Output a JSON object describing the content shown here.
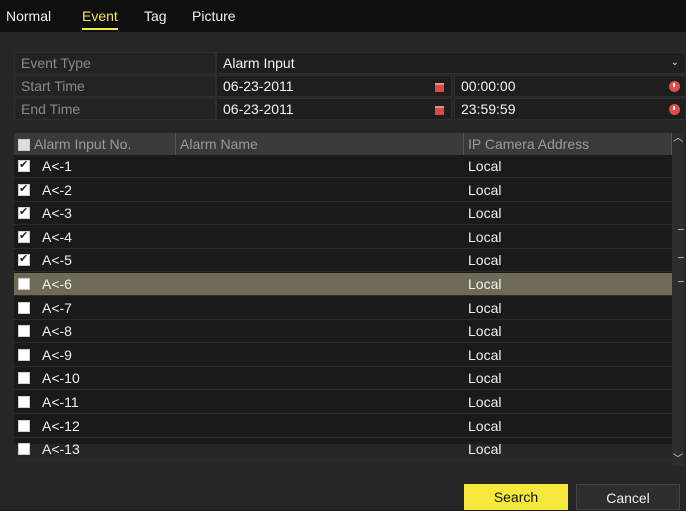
{
  "tabs": [
    {
      "label": "Normal"
    },
    {
      "label": "Event"
    },
    {
      "label": "Tag"
    },
    {
      "label": "Picture"
    }
  ],
  "active_tab": "Event",
  "form": {
    "event_type": {
      "label": "Event Type",
      "value": "Alarm Input"
    },
    "start_time": {
      "label": "Start Time",
      "date": "06-23-2011",
      "time": "00:00:00"
    },
    "end_time": {
      "label": "End Time",
      "date": "06-23-2011",
      "time": "23:59:59"
    }
  },
  "table": {
    "headers": [
      "Alarm Input No.",
      "Alarm Name",
      "IP Camera Address"
    ],
    "rows": [
      {
        "no": "A<-1",
        "name": "",
        "ip": "Local",
        "checked": true
      },
      {
        "no": "A<-2",
        "name": "",
        "ip": "Local",
        "checked": true
      },
      {
        "no": "A<-3",
        "name": "",
        "ip": "Local",
        "checked": true
      },
      {
        "no": "A<-4",
        "name": "",
        "ip": "Local",
        "checked": true
      },
      {
        "no": "A<-5",
        "name": "",
        "ip": "Local",
        "checked": true
      },
      {
        "no": "A<-6",
        "name": "",
        "ip": "Local",
        "checked": false,
        "selected": true
      },
      {
        "no": "A<-7",
        "name": "",
        "ip": "Local",
        "checked": false
      },
      {
        "no": "A<-8",
        "name": "",
        "ip": "Local",
        "checked": false
      },
      {
        "no": "A<-9",
        "name": "",
        "ip": "Local",
        "checked": false
      },
      {
        "no": "A<-10",
        "name": "",
        "ip": "Local",
        "checked": false
      },
      {
        "no": "A<-11",
        "name": "",
        "ip": "Local",
        "checked": false
      },
      {
        "no": "A<-12",
        "name": "",
        "ip": "Local",
        "checked": false
      },
      {
        "no": "A<-13",
        "name": "",
        "ip": "Local",
        "checked": false
      }
    ]
  },
  "buttons": {
    "search": "Search",
    "cancel": "Cancel"
  },
  "colors": {
    "accent": "#f7e93b",
    "selected_row": "#6e6a55",
    "icon_red": "#e04b4b"
  }
}
